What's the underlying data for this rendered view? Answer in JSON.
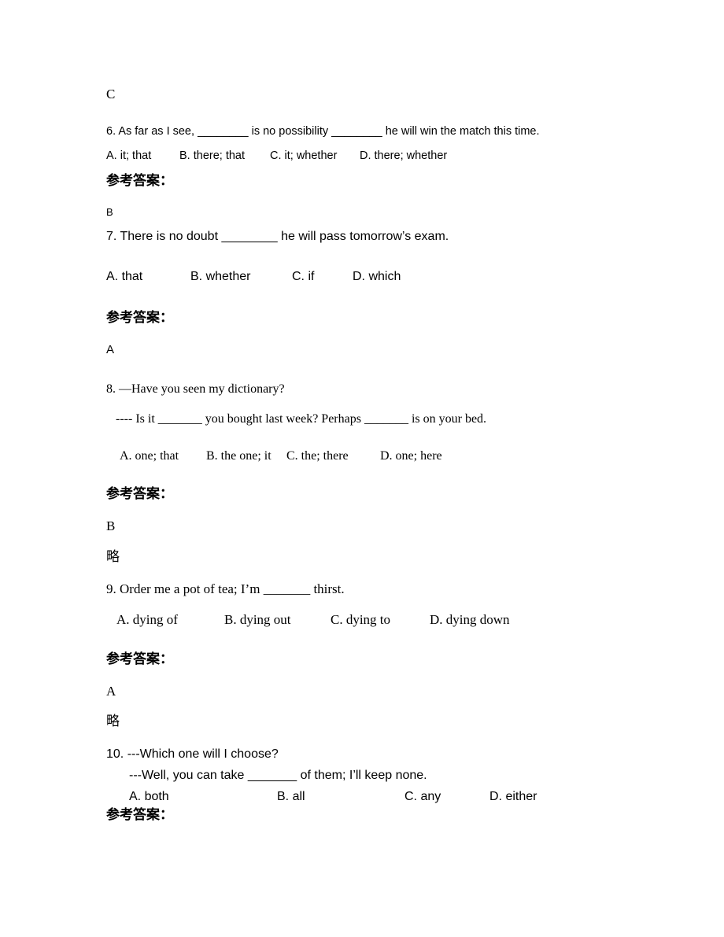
{
  "page": {
    "prev_answer": "C",
    "answer_heading": "参考答案：",
    "questions": [
      {
        "number": "6.",
        "stem_parts": [
          "6. As far as I see, ",
          "________",
          " is no possibility ",
          "________",
          " he will win the match this time."
        ],
        "options": [
          "A. it; that",
          "B. there; that",
          "C. it; whether",
          "D. there; whether"
        ],
        "answer": "B",
        "note": ""
      },
      {
        "number": "7.",
        "stem_parts": [
          "7. There is no doubt ",
          "________",
          " he will pass tomorrow’s exam."
        ],
        "options": [
          "A. that",
          "B. whether",
          "C. if",
          "D. which"
        ],
        "answer": "A",
        "note": ""
      },
      {
        "number": "8.",
        "stem_line1": "8. —Have you seen my dictionary?",
        "stem_line2_parts": [
          "---- Is it ",
          "_______",
          " you bought last week? Perhaps ",
          "_______",
          " is on your bed."
        ],
        "options": [
          "A. one; that",
          "B. the one; it",
          "C. the; there",
          "D. one; here"
        ],
        "answer": "B",
        "note": "略"
      },
      {
        "number": "9.",
        "stem_parts": [
          "9. Order me a pot of tea; I’m ",
          "_______",
          " thirst."
        ],
        "options": [
          "A. dying of",
          "B. dying out",
          "C. dying to",
          "D. dying down"
        ],
        "answer": "A",
        "note": "略"
      },
      {
        "number": "10.",
        "stem_line1": "10. ---Which one will I choose?",
        "stem_line2_parts": [
          "---Well, you can take ",
          "_______",
          " of them; I’ll keep none."
        ],
        "options": [
          "A. both",
          "B. all",
          "C. any",
          "D. either"
        ],
        "answer": "",
        "note": ""
      }
    ]
  }
}
